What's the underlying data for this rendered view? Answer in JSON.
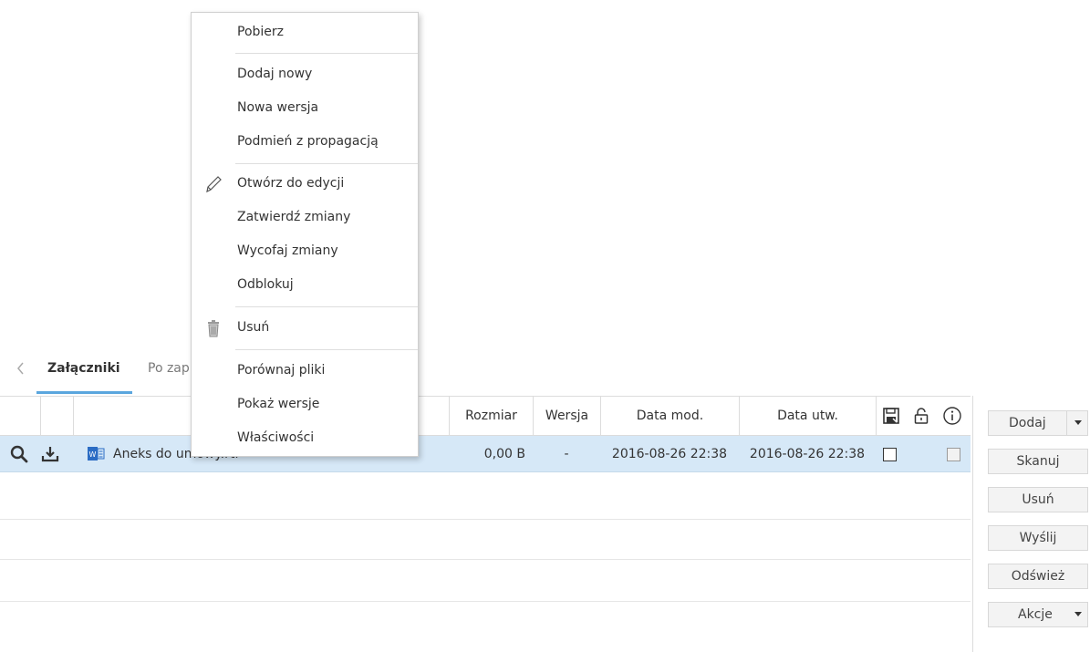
{
  "context_menu": {
    "items": [
      {
        "label": "Pobierz"
      },
      {
        "label": "Dodaj nowy"
      },
      {
        "label": "Nowa wersja"
      },
      {
        "label": "Podmień z propagacją"
      },
      {
        "label": "Otwórz do edycji",
        "icon": "pencil-icon"
      },
      {
        "label": "Zatwierdź zmiany"
      },
      {
        "label": "Wycofaj zmiany"
      },
      {
        "label": "Odblokuj"
      },
      {
        "label": "Usuń",
        "icon": "trash-icon"
      },
      {
        "label": "Porównaj pliki"
      },
      {
        "label": "Pokaż wersje"
      },
      {
        "label": "Właściwości"
      }
    ]
  },
  "tabs": {
    "back_icon": "chevron-left-icon",
    "items": [
      {
        "label": "Załączniki",
        "active": true
      },
      {
        "label": "Po zap",
        "active": false
      }
    ]
  },
  "grid": {
    "columns": {
      "size": "Rozmiar",
      "version": "Wersja",
      "modified": "Data mod.",
      "created": "Data utw.",
      "save_icon": "save-icon",
      "lock_icon": "lock-icon",
      "info_icon": "info-icon"
    },
    "rows": [
      {
        "name": "Aneks do umowy.rtf",
        "file_icon": "word-document-icon",
        "size": "0,00 B",
        "version": "-",
        "modified": "2016-08-26 22:38",
        "created": "2016-08-26 22:38",
        "selected": true
      }
    ]
  },
  "side_panel": {
    "add": "Dodaj",
    "scan": "Skanuj",
    "delete": "Usuń",
    "send": "Wyślij",
    "refresh": "Odśwież",
    "actions": "Akcje"
  },
  "colors": {
    "selected_row": "#d6e8f7",
    "tab_accent": "#5aa6de",
    "word_icon": "#2b6cc4"
  }
}
